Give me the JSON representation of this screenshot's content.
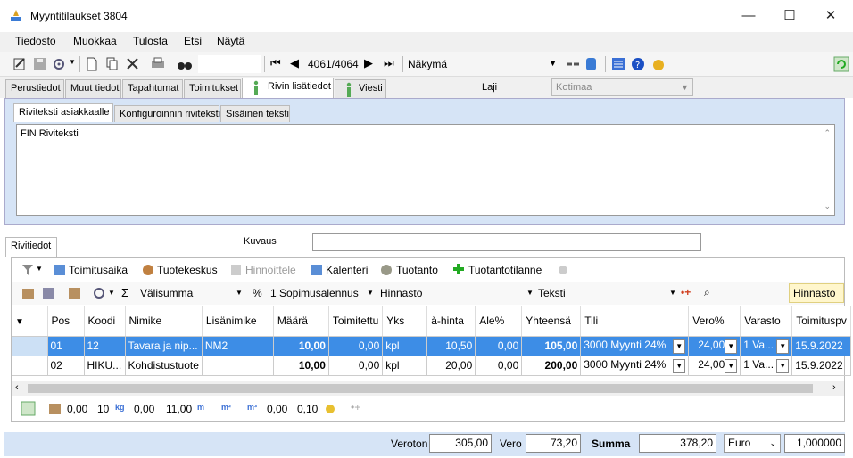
{
  "window": {
    "title": "Myyntitilaukset 3804",
    "min": "—",
    "max": "☐",
    "close": "✕"
  },
  "menu": [
    "Tiedosto",
    "Muokkaa",
    "Tulosta",
    "Etsi",
    "Näytä"
  ],
  "toolbar": {
    "record": "4061/4064",
    "view_label": "Näkymä"
  },
  "main_tabs": [
    "Perustiedot",
    "Muut tiedot",
    "Tapahtumat",
    "Toimitukset",
    "Rivin lisätiedot",
    "Viesti"
  ],
  "laji": {
    "label": "Laji",
    "value": "Kotimaa"
  },
  "text_tabs": [
    "Riviteksti asiakkaalle",
    "Konfiguroinnin riviteksti",
    "Sisäinen teksti"
  ],
  "riviteksti": "FIN Riviteksti",
  "rivitiedot": {
    "tab": "Rivitiedot",
    "kuvaus_label": "Kuvaus",
    "kuvaus_value": ""
  },
  "toolbar2": [
    "Toimitusaika",
    "Tuotekeskus",
    "Hinnoittele",
    "Kalenteri",
    "Tuotanto",
    "Tuotantotilanne"
  ],
  "toolbar3": {
    "sum": "Välisumma",
    "pct": "%",
    "discount": "1 Sopimusalennus",
    "price": "Hinnasto",
    "text": "Teksti",
    "hinnasto_btn": "Hinnasto"
  },
  "columns": [
    "Pos",
    "Koodi",
    "Nimike",
    "Lisänimike",
    "Määrä",
    "Toimitettu",
    "Yks",
    "à-hinta",
    "Ale%",
    "Yhteensä",
    "Tili",
    "Vero%",
    "Varasto",
    "Toimituspv"
  ],
  "rows": [
    {
      "pos": "01",
      "koodi": "12",
      "nimike": "Tavara ja nip...",
      "lisa": "NM2",
      "maara": "10,00",
      "toim": "0,00",
      "yks": "kpl",
      "hinta": "10,50",
      "ale": "0,00",
      "yht": "105,00",
      "tili": "3000 Myynti 24%",
      "vero": "24,00",
      "varasto": "1 Va...",
      "pvm": "15.9.2022"
    },
    {
      "pos": "02",
      "koodi": "HIKU...",
      "nimike": "Kohdistustuote",
      "lisa": "",
      "maara": "10,00",
      "toim": "0,00",
      "yks": "kpl",
      "hinta": "20,00",
      "ale": "0,00",
      "yht": "200,00",
      "tili": "3000 Myynti 24%",
      "vero": "24,00",
      "varasto": "1 Va...",
      "pvm": "15.9.2022"
    }
  ],
  "footer": {
    "a": "0,00",
    "b": "10",
    "c": "0,00",
    "d": "11,00",
    "e": "0,00",
    "f": "0,10"
  },
  "totals": {
    "veroton_label": "Veroton",
    "veroton": "305,00",
    "vero_label": "Vero",
    "vero": "73,20",
    "summa_label": "Summa",
    "summa": "378,20",
    "currency": "Euro",
    "rate": "1,000000"
  }
}
